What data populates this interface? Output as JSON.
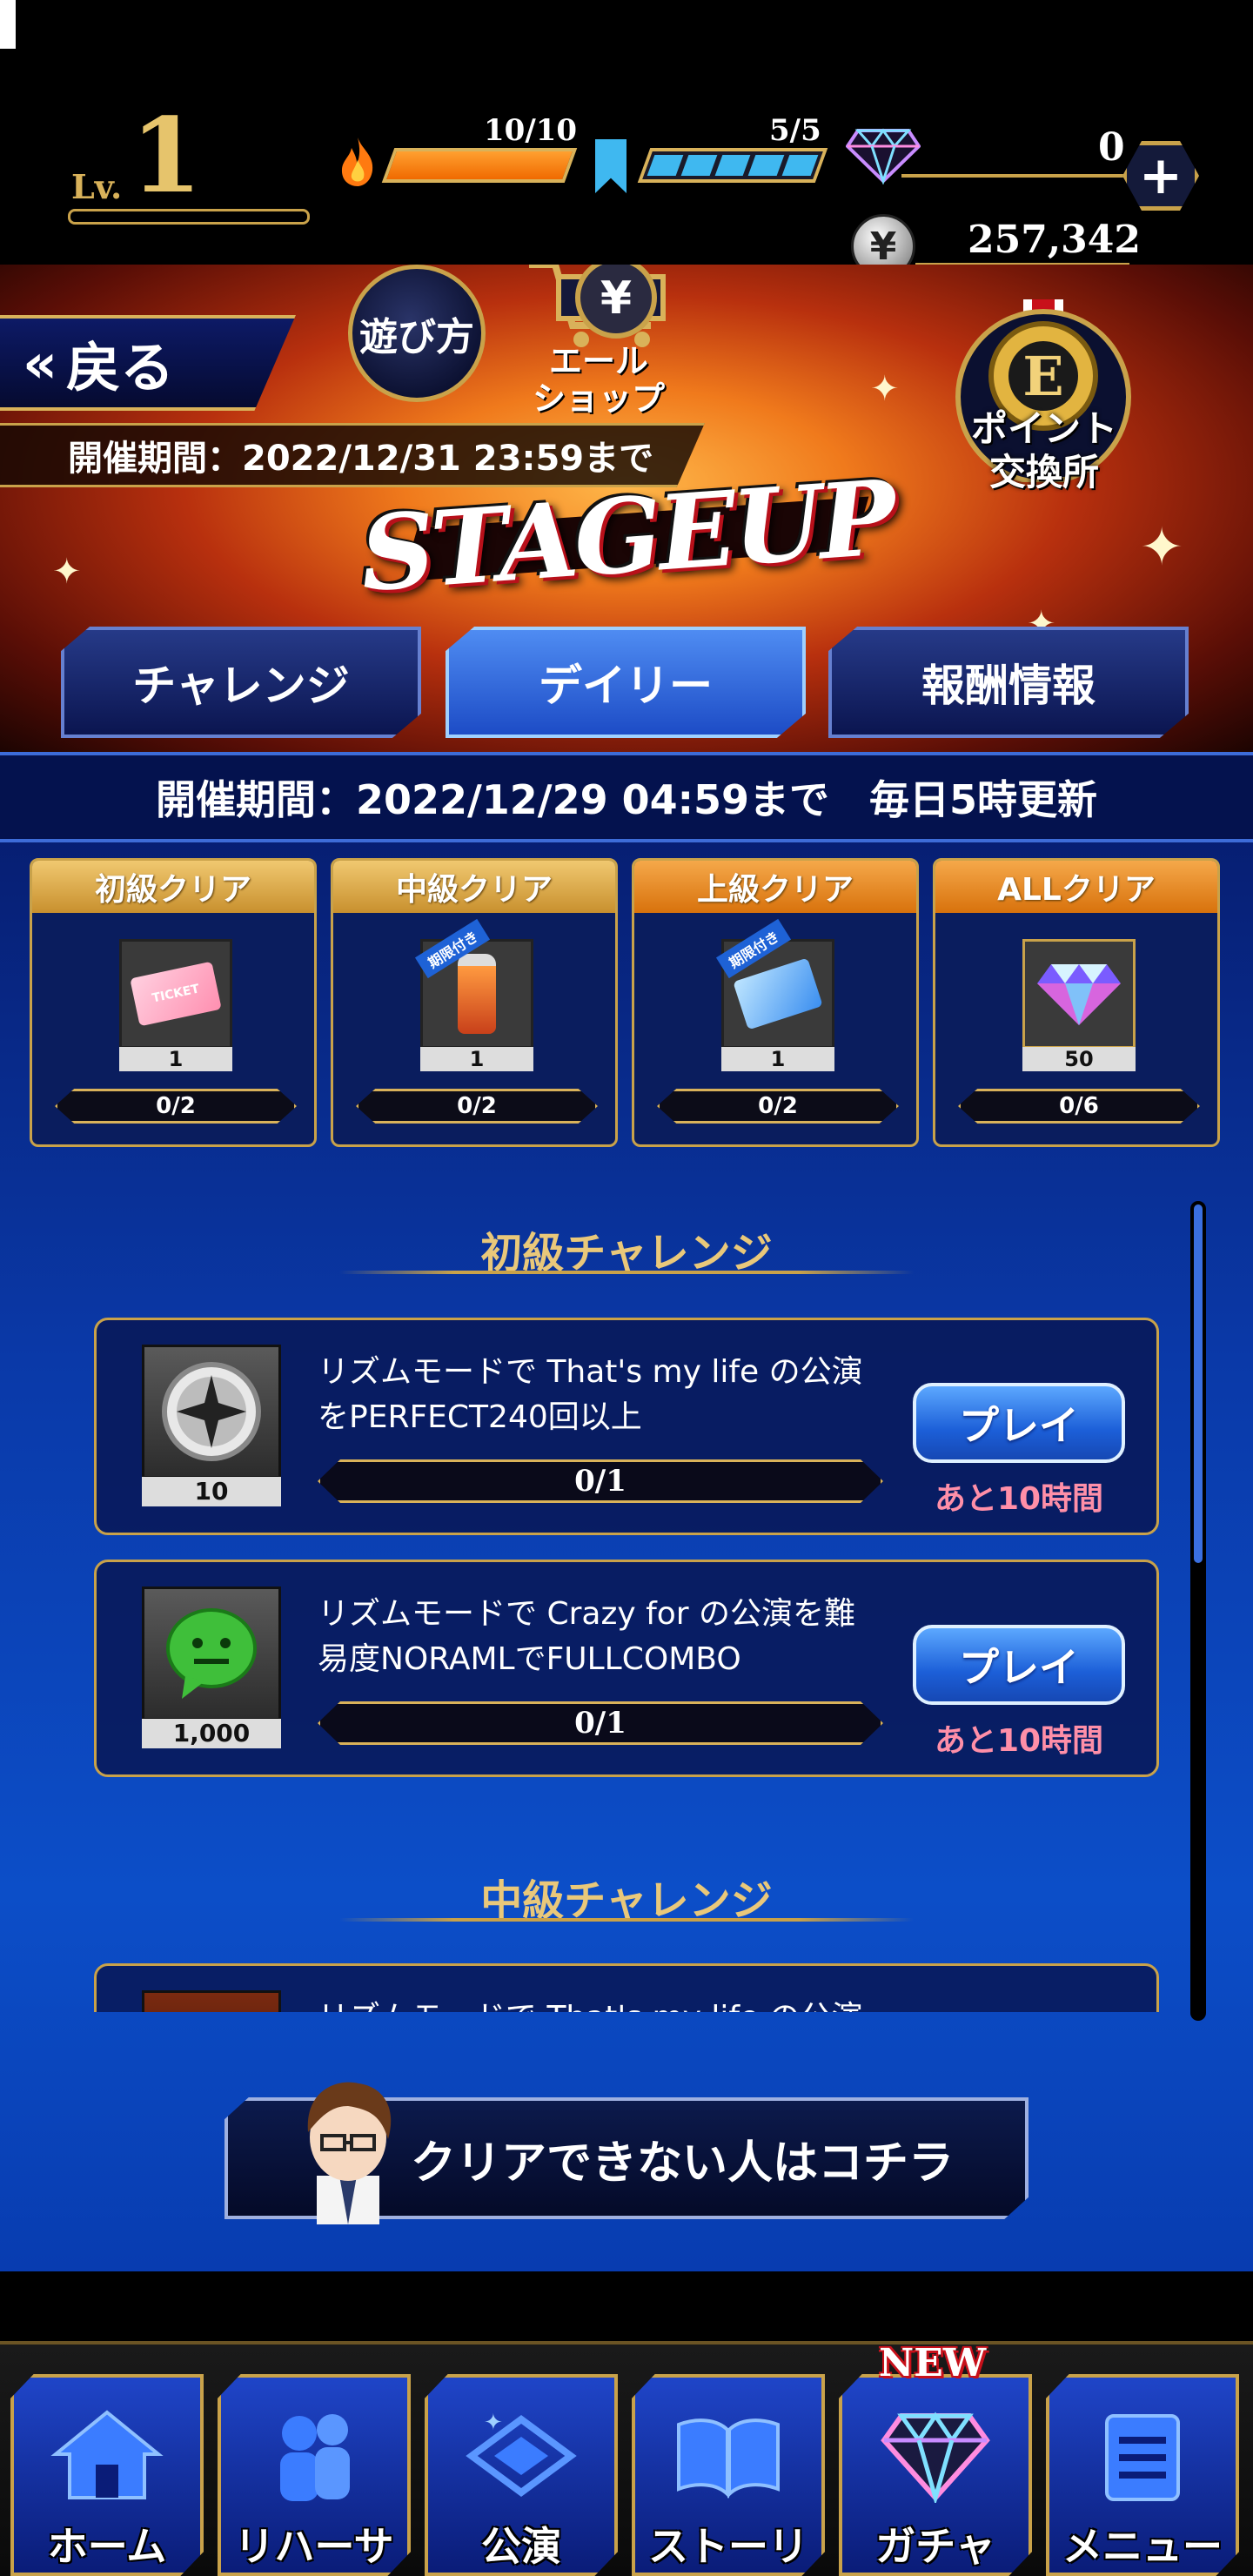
{
  "status": {
    "level_prefix": "Lv.",
    "level": "1",
    "stamina": "10/10",
    "tickets": "5/5",
    "gems": "0",
    "yen": "257,342"
  },
  "banner": {
    "back_label": "戻る",
    "howto_label": "遊び方",
    "shop_label_1": "エール",
    "shop_label_2": "ショップ",
    "event_period": "開催期間：2022/12/31 23:59まで",
    "logo_text": "STAGEUP",
    "point_exchange_1": "ポイント",
    "point_exchange_2": "交換所"
  },
  "tabs": [
    {
      "label": "チャレンジ",
      "active": false
    },
    {
      "label": "デイリー",
      "active": true
    },
    {
      "label": "報酬情報",
      "active": false
    }
  ],
  "daily": {
    "period": "開催期間：2022/12/29 04:59まで　毎日5時更新"
  },
  "rewards": [
    {
      "title": "初級クリア",
      "qty": "1",
      "progress": "0/2",
      "item": "ticket-icon",
      "limited": "",
      "header_color": "#d7a64a"
    },
    {
      "title": "中級クリア",
      "qty": "1",
      "progress": "0/2",
      "item": "drink-bottle-icon",
      "limited": "期限付き",
      "header_color": "#d7a64a"
    },
    {
      "title": "上級クリア",
      "qty": "1",
      "progress": "0/2",
      "item": "blue-ticket-icon",
      "limited": "期限付き",
      "header_color": "#e08a1e"
    },
    {
      "title": "ALLクリア",
      "qty": "50",
      "progress": "0/6",
      "item": "diamond-icon",
      "limited": "",
      "header_color": "#e08a1e"
    }
  ],
  "sections": {
    "beginner": "初級チャレンジ",
    "intermediate": "中級チャレンジ"
  },
  "missions": [
    {
      "text1": "リズムモードで That's my life の公演",
      "text2": "をPERFECT240回以上",
      "qty": "10",
      "progress": "0/1",
      "play": "プレイ",
      "remaining": "あと10時間",
      "icon": "star-medal-icon"
    },
    {
      "text1": "リズムモードで Crazy for の公演を難",
      "text2": "易度NORAMLでFULLCOMBO",
      "qty": "1,000",
      "progress": "0/1",
      "play": "プレイ",
      "remaining": "あと10時間",
      "icon": "chat-face-icon"
    },
    {
      "text1": "リズムモードで That's my life の公演",
      "text2": "",
      "qty": "",
      "progress": "",
      "play": "",
      "remaining": "",
      "icon": "fire-icon"
    }
  ],
  "help_button": "クリアできない人はコチラ",
  "nav": [
    {
      "label": "ホーム",
      "icon": "home-icon"
    },
    {
      "label": "リハーサル",
      "icon": "rehearsal-icon"
    },
    {
      "label": "公演",
      "icon": "stage-icon"
    },
    {
      "label": "ストーリー",
      "icon": "book-icon"
    },
    {
      "label": "ガチャ",
      "icon": "gacha-gem-icon"
    },
    {
      "label": "メニュー",
      "icon": "menu-icon"
    }
  ],
  "new_badge": "NEW",
  "colors": {
    "gold": "#c9a24a",
    "accent_blue": "#1d4cc6",
    "remaining_pink": "#ff8fa8"
  }
}
